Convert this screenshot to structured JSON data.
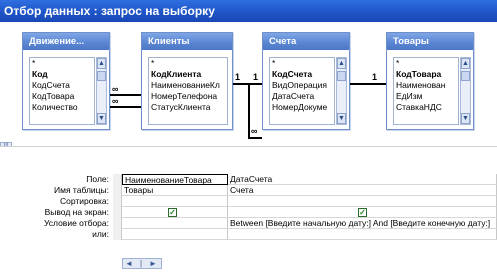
{
  "window": {
    "title": "Отбор данных : запрос на выборку"
  },
  "tables": [
    {
      "title": "Движение...",
      "fields": [
        {
          "name": "*",
          "key": false
        },
        {
          "name": "Код",
          "key": true
        },
        {
          "name": "КодСчета",
          "key": false
        },
        {
          "name": "КодТовара",
          "key": false
        },
        {
          "name": "Количество",
          "key": false
        }
      ]
    },
    {
      "title": "Клиенты",
      "fields": [
        {
          "name": "*",
          "key": false
        },
        {
          "name": "КодКлиента",
          "key": true
        },
        {
          "name": "НаименованиеКл",
          "key": false
        },
        {
          "name": "НомерТелефона",
          "key": false
        },
        {
          "name": "СтатусКлиента",
          "key": false
        }
      ]
    },
    {
      "title": "Счета",
      "fields": [
        {
          "name": "*",
          "key": false
        },
        {
          "name": "КодСчета",
          "key": true
        },
        {
          "name": "ВидОперация",
          "key": false
        },
        {
          "name": "ДатаСчета",
          "key": false
        },
        {
          "name": "НомерДокуме",
          "key": false
        }
      ]
    },
    {
      "title": "Товары",
      "fields": [
        {
          "name": "*",
          "key": false
        },
        {
          "name": "КодТовара",
          "key": true
        },
        {
          "name": "Наименован",
          "key": false
        },
        {
          "name": "ЕдИзм",
          "key": false
        },
        {
          "name": "СтавкаНДС",
          "key": false
        }
      ]
    }
  ],
  "relationships": {
    "one_label": "1",
    "many_label": "∞"
  },
  "grid": {
    "row_labels": {
      "field": "Поле:",
      "table": "Имя таблицы:",
      "sort": "Сортировка:",
      "show": "Вывод на экран:",
      "criteria": "Условие отбора:",
      "or": "или:"
    },
    "columns": [
      {
        "field": "НаименованиеТовара",
        "table": "Товары",
        "sort": "",
        "show": true,
        "criteria": "",
        "or": ""
      },
      {
        "field": "ДатаСчета",
        "table": "Счета",
        "sort": "",
        "show": true,
        "criteria": "Between [Введите начальную дату:] And [Введите конечную дату:]",
        "or": ""
      }
    ]
  },
  "colors": {
    "titlebar": "#1f55c8",
    "table_header": "#5884d2",
    "check": "#1f8a1f"
  },
  "icons": {
    "scroll_up": "▲",
    "scroll_down": "▼",
    "scroll_left": "◄",
    "scroll_right": "►",
    "check": "✓"
  }
}
